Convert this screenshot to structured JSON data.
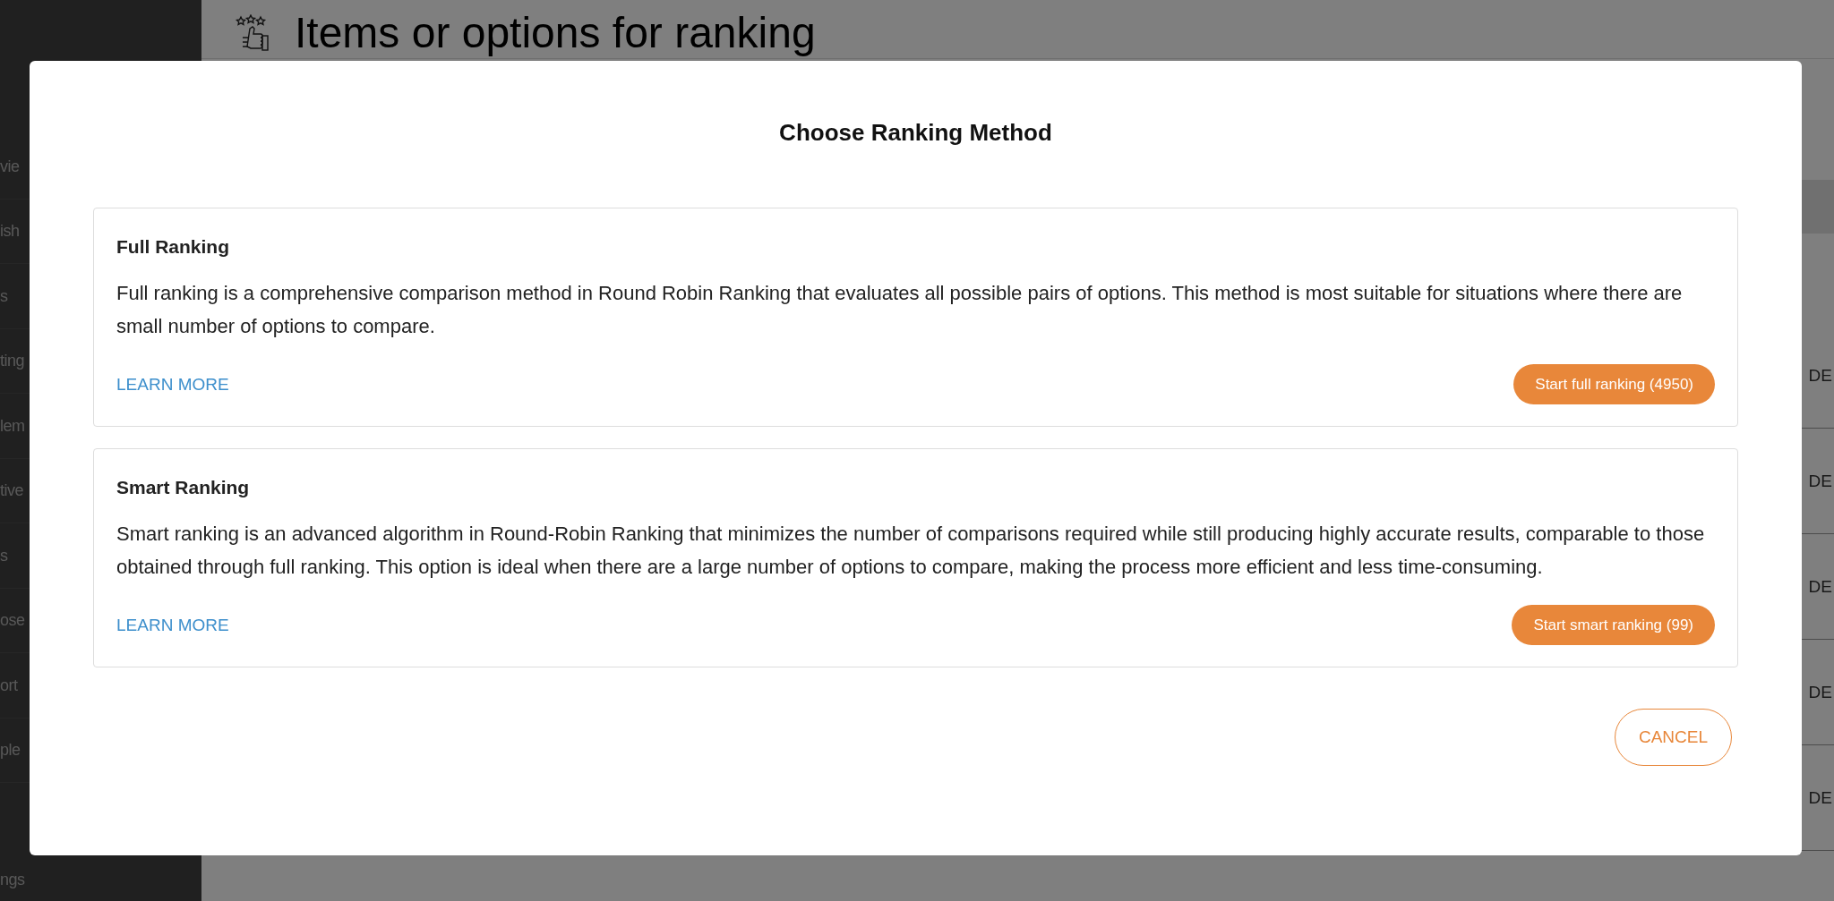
{
  "sidebar": {
    "items": [
      {
        "label": "vie"
      },
      {
        "label": "ish"
      },
      {
        "label": "s"
      },
      {
        "label": "ting"
      },
      {
        "label": "lem"
      },
      {
        "label": "tive"
      },
      {
        "label": "s"
      },
      {
        "label": "ose"
      },
      {
        "label": "ort"
      },
      {
        "label": "ple"
      },
      {
        "label": "ngs"
      }
    ]
  },
  "header": {
    "title": "Items or options for ranking"
  },
  "rows": [
    {
      "label": "DE"
    },
    {
      "label": "DE"
    },
    {
      "label": "DE"
    },
    {
      "label": "DE"
    },
    {
      "label": "DE"
    }
  ],
  "dialog": {
    "title": "Choose Ranking Method",
    "options": [
      {
        "title": "Full Ranking",
        "description": "Full ranking is a comprehensive comparison method in Round Robin Ranking that evaluates all possible pairs of options. This method is most suitable for situations where there are small number of options to compare.",
        "link": "LEARN MORE",
        "button": "Start full ranking (4950)"
      },
      {
        "title": "Smart Ranking",
        "description": "Smart ranking is an advanced algorithm in Round-Robin Ranking that minimizes the number of comparisons required while still producing highly accurate results, comparable to those obtained through full ranking. This option is ideal when there are a large number of options to compare, making the process more efficient and less time-consuming.",
        "link": "LEARN MORE",
        "button": "Start smart ranking (99)"
      }
    ],
    "cancel": "CANCEL"
  }
}
